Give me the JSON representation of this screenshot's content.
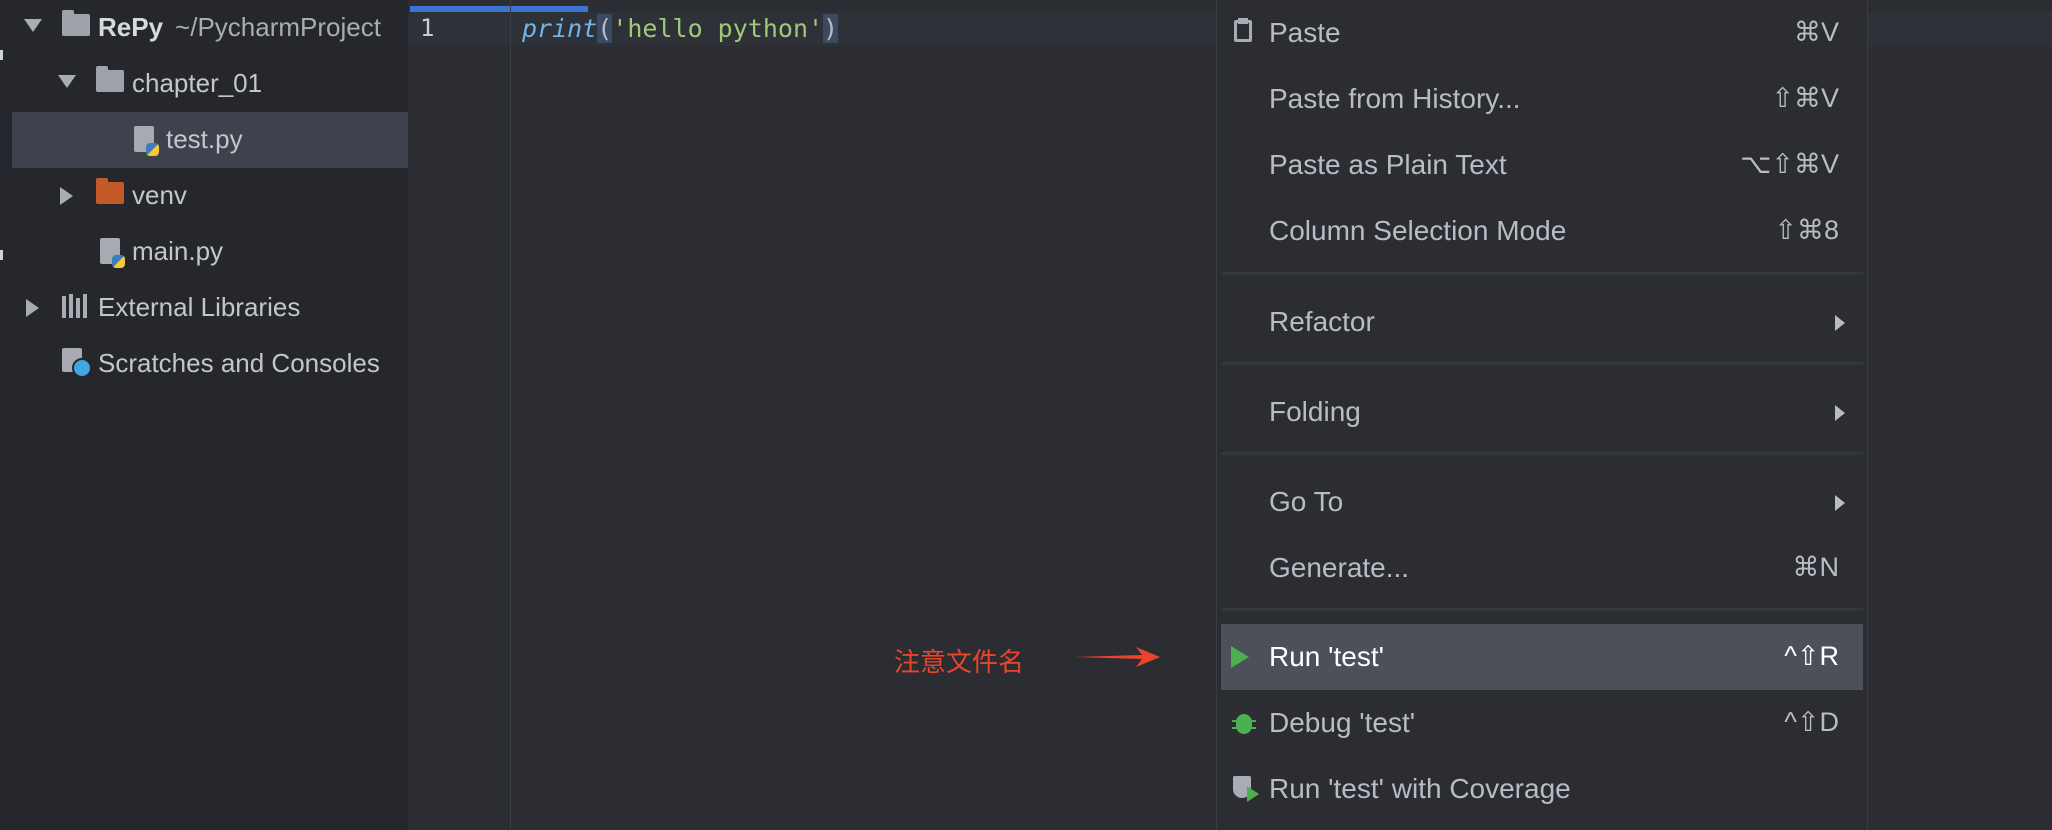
{
  "project_tree": {
    "root": {
      "name": "RePy",
      "path": "~/PycharmProject"
    },
    "items": [
      {
        "label": "chapter_01"
      },
      {
        "label": "test.py"
      },
      {
        "label": "venv"
      },
      {
        "label": "main.py"
      },
      {
        "label": "External Libraries"
      },
      {
        "label": "Scratches and Consoles"
      }
    ]
  },
  "editor": {
    "line_number": "1",
    "code": {
      "func": "print",
      "open": "(",
      "string": "'hello python'",
      "close": ")"
    },
    "annotation": "注意文件名"
  },
  "context_menu": {
    "items": [
      {
        "label": "Paste",
        "shortcut": "⌘V"
      },
      {
        "label": "Paste from History...",
        "shortcut": "⇧⌘V"
      },
      {
        "label": "Paste as Plain Text",
        "shortcut": "⌥⇧⌘V"
      },
      {
        "label": "Column Selection Mode",
        "shortcut": "⇧⌘8"
      },
      {
        "label": "Refactor"
      },
      {
        "label": "Folding"
      },
      {
        "label": "Go To"
      },
      {
        "label": "Generate...",
        "shortcut": "⌘N"
      },
      {
        "label": "Run 'test'",
        "shortcut": "^⇧R"
      },
      {
        "label": "Debug 'test'",
        "shortcut": "^⇧D"
      },
      {
        "label": "Run 'test' with Coverage"
      }
    ]
  },
  "colors": {
    "accent": "#3c74d4",
    "annotation": "#e8452c",
    "run_green": "#4caf50",
    "venv_folder": "#c45a28"
  }
}
